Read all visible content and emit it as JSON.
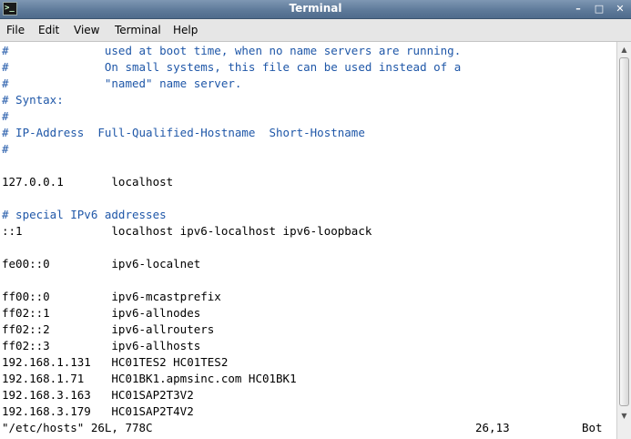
{
  "window": {
    "title": "Terminal",
    "app_icon_glyph": ">_",
    "controls": {
      "minimize": "–",
      "maximize": "□",
      "close": "✕"
    }
  },
  "menubar": {
    "items": [
      "File",
      "Edit",
      "View",
      "Terminal",
      "Help"
    ]
  },
  "colors": {
    "comment": "#1f57a8",
    "text": "#000000",
    "background": "#ffffff"
  },
  "editor": {
    "lines": [
      {
        "code": "",
        "comment": "#              used at boot time, when no name servers are running."
      },
      {
        "code": "",
        "comment": "#              On small systems, this file can be used instead of a"
      },
      {
        "code": "",
        "comment": "#              \"named\" name server."
      },
      {
        "code": "",
        "comment": "# Syntax:"
      },
      {
        "code": "",
        "comment": "#"
      },
      {
        "code": "",
        "comment": "# IP-Address  Full-Qualified-Hostname  Short-Hostname"
      },
      {
        "code": "",
        "comment": "#"
      },
      {
        "code": "",
        "comment": ""
      },
      {
        "code": "127.0.0.1       localhost",
        "comment": ""
      },
      {
        "code": "",
        "comment": ""
      },
      {
        "code": "",
        "comment": "# special IPv6 addresses"
      },
      {
        "code": "::1             localhost ipv6-localhost ipv6-loopback",
        "comment": ""
      },
      {
        "code": "",
        "comment": ""
      },
      {
        "code": "fe00::0         ipv6-localnet",
        "comment": ""
      },
      {
        "code": "",
        "comment": ""
      },
      {
        "code": "ff00::0         ipv6-mcastprefix",
        "comment": ""
      },
      {
        "code": "ff02::1         ipv6-allnodes",
        "comment": ""
      },
      {
        "code": "ff02::2         ipv6-allrouters",
        "comment": ""
      },
      {
        "code": "ff02::3         ipv6-allhosts",
        "comment": ""
      },
      {
        "code": "192.168.1.131   HC01TES2 HC01TES2",
        "comment": ""
      },
      {
        "code": "192.168.1.71    HC01BK1.apmsinc.com HC01BK1",
        "comment": ""
      },
      {
        "code": "192.168.3.163   HC01SAP2T3V2",
        "comment": ""
      },
      {
        "code": "192.168.3.179   HC01SAP2T4V2",
        "comment": ""
      }
    ],
    "status": {
      "file": "\"/etc/hosts\" 26L, 778C",
      "cursor": "26,13",
      "position": "Bot"
    }
  }
}
